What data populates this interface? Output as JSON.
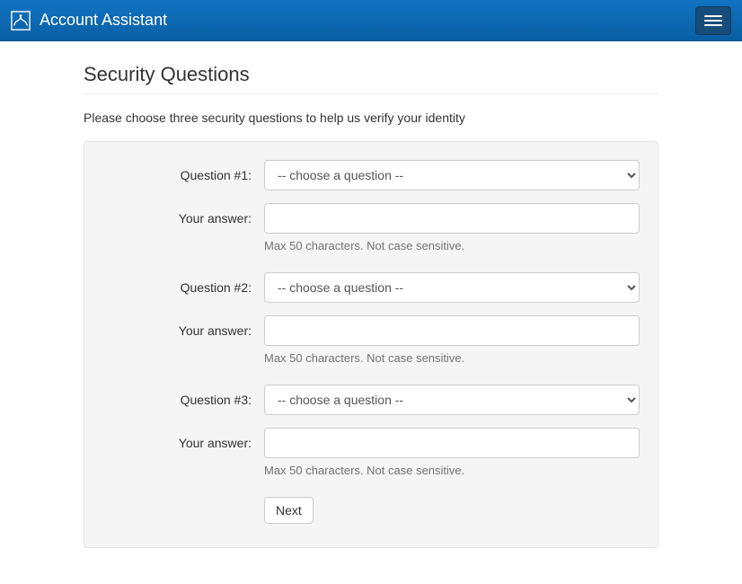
{
  "header": {
    "app_title": "Account Assistant"
  },
  "page": {
    "title": "Security Questions",
    "subtitle": "Please choose three security questions to help us verify your identity"
  },
  "form": {
    "groups": [
      {
        "question_label": "Question #1:",
        "question_selected": "-- choose a question --",
        "answer_label": "Your answer:",
        "answer_value": "",
        "help": "Max 50 characters. Not case sensitive."
      },
      {
        "question_label": "Question #2:",
        "question_selected": "-- choose a question --",
        "answer_label": "Your answer:",
        "answer_value": "",
        "help": "Max 50 characters. Not case sensitive."
      },
      {
        "question_label": "Question #3:",
        "question_selected": "-- choose a question --",
        "answer_label": "Your answer:",
        "answer_value": "",
        "help": "Max 50 characters. Not case sensitive."
      }
    ],
    "next_label": "Next"
  }
}
